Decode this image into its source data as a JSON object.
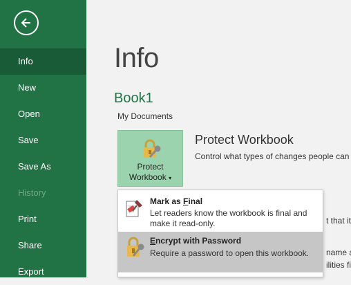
{
  "sidebar": {
    "items": [
      {
        "label": "Info",
        "active": true
      },
      {
        "label": "New"
      },
      {
        "label": "Open"
      },
      {
        "label": "Save"
      },
      {
        "label": "Save As"
      },
      {
        "label": "History",
        "disabled": true
      },
      {
        "label": "Print"
      },
      {
        "label": "Share"
      },
      {
        "label": "Export"
      }
    ],
    "colors": {
      "background": "#217346",
      "active": "#195a37",
      "disabled_text": "#6fa985"
    }
  },
  "main": {
    "title": "Info",
    "workbook_name": "Book1",
    "workbook_location": "My Documents",
    "protect": {
      "button_line1": "Protect",
      "button_line2": "Workbook",
      "dropdown_glyph": "▾",
      "title": "Protect Workbook",
      "description": "Control what types of changes people can"
    },
    "background_fragments": [
      "t that it",
      "name a",
      "ilities fi"
    ]
  },
  "menu": {
    "items": [
      {
        "title_prefix": "Mark as ",
        "title_underlined": "F",
        "title_suffix": "inal",
        "description": "Let readers know the workbook is final and make it read-only.",
        "icon": "mark-final-icon"
      },
      {
        "title_prefix": "",
        "title_underlined": "E",
        "title_suffix": "ncrypt with Password",
        "description": "Require a password to open this workbook.",
        "icon": "lock-key-icon",
        "highlighted": true
      }
    ]
  }
}
